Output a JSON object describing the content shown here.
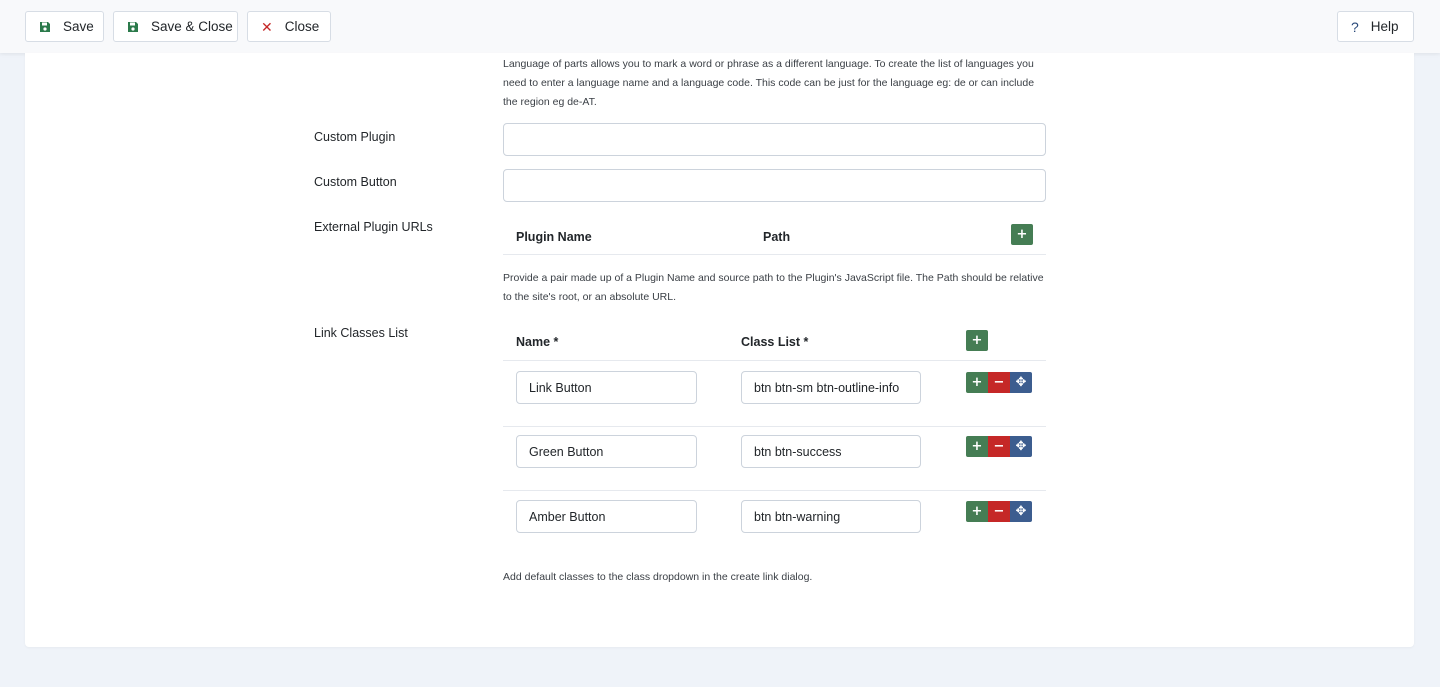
{
  "toolbar": {
    "save_label": "Save",
    "save_close_label": "Save & Close",
    "close_label": "Close",
    "help_label": "Help"
  },
  "form": {
    "language_desc": "Language of parts allows you to mark a word or phrase as a different language. To create the list of languages you need to enter a language name and a language code. This code can be just for the language eg: de or can include the region eg de-AT.",
    "custom_plugin": {
      "label": "Custom Plugin",
      "value": ""
    },
    "custom_button": {
      "label": "Custom Button",
      "value": ""
    },
    "external_plugins": {
      "label": "External Plugin URLs",
      "col_name": "Plugin Name",
      "col_path": "Path",
      "desc": "Provide a pair made up of a Plugin Name and source path to the Plugin's JavaScript file. The Path should be relative to the site's root, or an absolute URL."
    },
    "link_classes": {
      "label": "Link Classes List",
      "col_name": "Name *",
      "col_class": "Class List *",
      "rows": [
        {
          "name": "Link Button",
          "class_list": "btn btn-sm btn-outline-info"
        },
        {
          "name": "Green Button",
          "class_list": "btn btn-success"
        },
        {
          "name": "Amber Button",
          "class_list": "btn btn-warning"
        }
      ],
      "desc": "Add default classes to the class dropdown in the create link dialog."
    }
  },
  "colors": {
    "add": "#457d54",
    "remove": "#c52827",
    "move": "#3c5d8f",
    "close_x": "#c52827"
  },
  "icons": {
    "save": "floppy-disk-icon",
    "close": "close-icon",
    "help": "question-icon",
    "add": "plus-icon",
    "remove": "minus-icon",
    "move": "move-arrows-icon"
  }
}
